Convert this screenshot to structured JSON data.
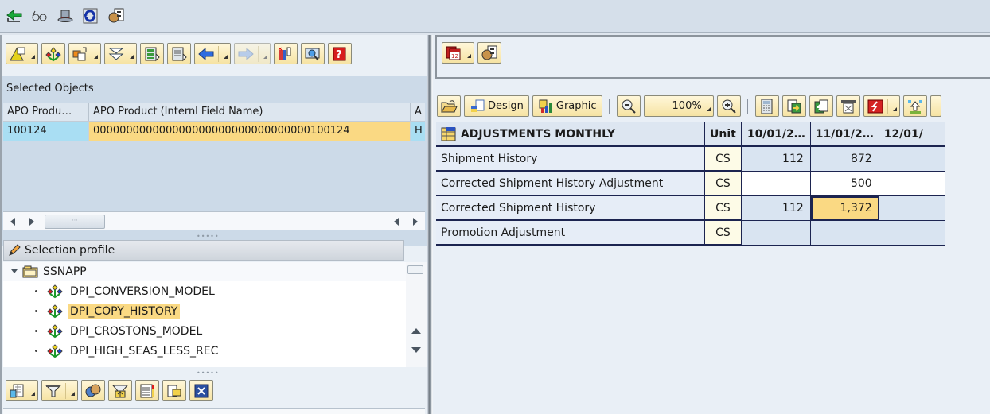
{
  "app_toolbar": {
    "icons": [
      "back-icon",
      "glasses-icon",
      "hat-icon",
      "refresh-icon",
      "settings-icon"
    ]
  },
  "left_toolbar": {
    "buttons": [
      "layout-menu",
      "planning-model",
      "copy-object",
      "filter-objects",
      "load-data",
      "display-list",
      "previous",
      "next",
      "column-settings",
      "search",
      "help"
    ]
  },
  "selected_objects": {
    "title": "Selected Objects",
    "columns": [
      "APO Produ…",
      "APO Product (Internl Field Name)",
      "A"
    ],
    "rows": [
      [
        "100124",
        "000000000000000000000000000000000100124",
        "H"
      ]
    ]
  },
  "selection_profile": {
    "title": "Selection profile",
    "root": "SSNAPP",
    "items": [
      {
        "label": "DPI_CONVERSION_MODEL",
        "selected": false
      },
      {
        "label": "DPI_COPY_HISTORY",
        "selected": true
      },
      {
        "label": "DPI_CROSTONS_MODEL",
        "selected": false
      },
      {
        "label": "DPI_HIGH_SEAS_LESS_REC",
        "selected": false
      }
    ]
  },
  "bottom_toolbar": {
    "buttons": [
      "table-view",
      "filter",
      "users",
      "unload",
      "notes",
      "copy-window",
      "close"
    ]
  },
  "right_toolbar": {
    "design_label": "Design",
    "graphic_label": "Graphic",
    "zoom_value": "100%"
  },
  "planning_table": {
    "title": "ADJUSTMENTS MONTHLY",
    "unit_header": "Unit",
    "date_headers": [
      "10/01/2…",
      "11/01/2…",
      "12/01/"
    ],
    "rows": [
      {
        "label": "Shipment History",
        "unit": "CS",
        "values": [
          "112",
          "872",
          ""
        ]
      },
      {
        "label": "Corrected Shipment History Adjustment",
        "unit": "CS",
        "values": [
          "",
          "500",
          ""
        ]
      },
      {
        "label": "Corrected Shipment History",
        "unit": "CS",
        "values": [
          "112",
          "1,372",
          ""
        ]
      },
      {
        "label": "Promotion Adjustment",
        "unit": "CS",
        "values": [
          "",
          "",
          ""
        ]
      }
    ]
  },
  "colors": {
    "highlight": "#fad983",
    "key_column": "#a9def3",
    "grid_line": "#1c2450"
  }
}
